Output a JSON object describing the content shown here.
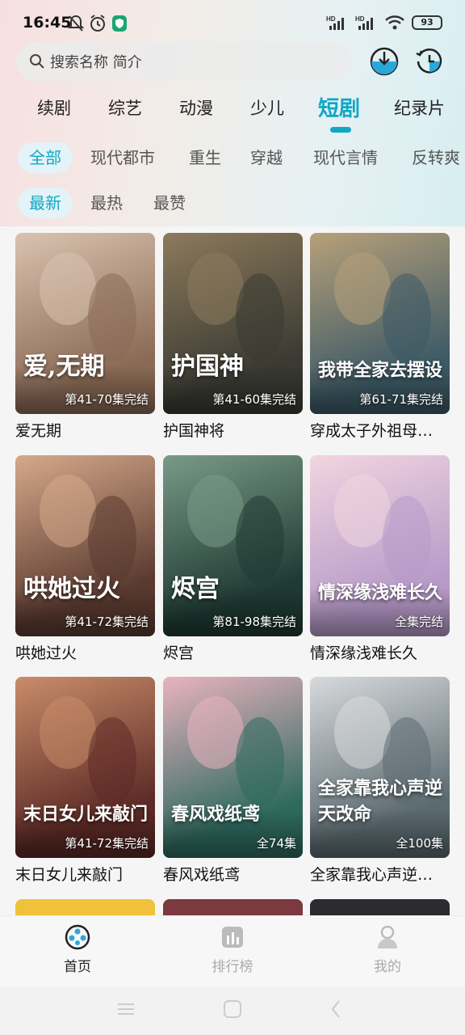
{
  "status_bar": {
    "time": "16:45",
    "battery": "93",
    "hd1": "HD",
    "hd2": "HD"
  },
  "search": {
    "placeholder": "搜索名称 简介"
  },
  "categories": [
    "续剧",
    "综艺",
    "动漫",
    "少儿",
    "短剧",
    "纪录片"
  ],
  "active_category": "短剧",
  "genres": [
    "全部",
    "现代都市",
    "重生",
    "穿越",
    "现代言情",
    "反转爽"
  ],
  "sorts": [
    "最新",
    "最热",
    "最赞"
  ],
  "dramas": [
    {
      "title": "爱无期",
      "episodes": "第41-70集完结",
      "art": "爱,无期",
      "colors": [
        "#8a6a55",
        "#d9c3b0"
      ]
    },
    {
      "title": "护国神将",
      "episodes": "第41-60集完结",
      "art": "护国神",
      "colors": [
        "#3a3a33",
        "#8c7a5c"
      ]
    },
    {
      "title": "穿成太子外祖母…",
      "episodes": "第61-71集完结",
      "art": "我带全家去摆设",
      "colors": [
        "#3d5a66",
        "#b7a07a"
      ]
    },
    {
      "title": "哄她过火",
      "episodes": "第41-72集完结",
      "art": "哄她过火",
      "colors": [
        "#5a3a30",
        "#d6a98a"
      ]
    },
    {
      "title": "烬宫",
      "episodes": "第81-98集完结",
      "art": "烬宫",
      "colors": [
        "#1f3a33",
        "#7a9a88"
      ]
    },
    {
      "title": "情深缘浅难长久",
      "episodes": "全集完结",
      "art": "情深缘浅难长久",
      "colors": [
        "#b79ac9",
        "#f1d5df"
      ]
    },
    {
      "title": "末日女儿来敲门",
      "episodes": "第41-72集完结",
      "art": "末日女儿来敲门",
      "colors": [
        "#5c2a26",
        "#c98d6a"
      ]
    },
    {
      "title": "春风戏纸鸢",
      "episodes": "全74集",
      "art": "春风戏纸鸢",
      "colors": [
        "#2f6a5e",
        "#e9b3c0"
      ]
    },
    {
      "title": "全家靠我心声逆…",
      "episodes": "全100集",
      "art": "全家靠我心声逆天改命",
      "colors": [
        "#5b6a70",
        "#d8dadc"
      ]
    }
  ],
  "bottom_nav": [
    {
      "label": "首页",
      "icon": "film-reel-icon",
      "active": true
    },
    {
      "label": "排行榜",
      "icon": "chart-icon",
      "active": false
    },
    {
      "label": "我的",
      "icon": "user-icon",
      "active": false
    }
  ],
  "colors": {
    "accent": "#10a8c4"
  }
}
